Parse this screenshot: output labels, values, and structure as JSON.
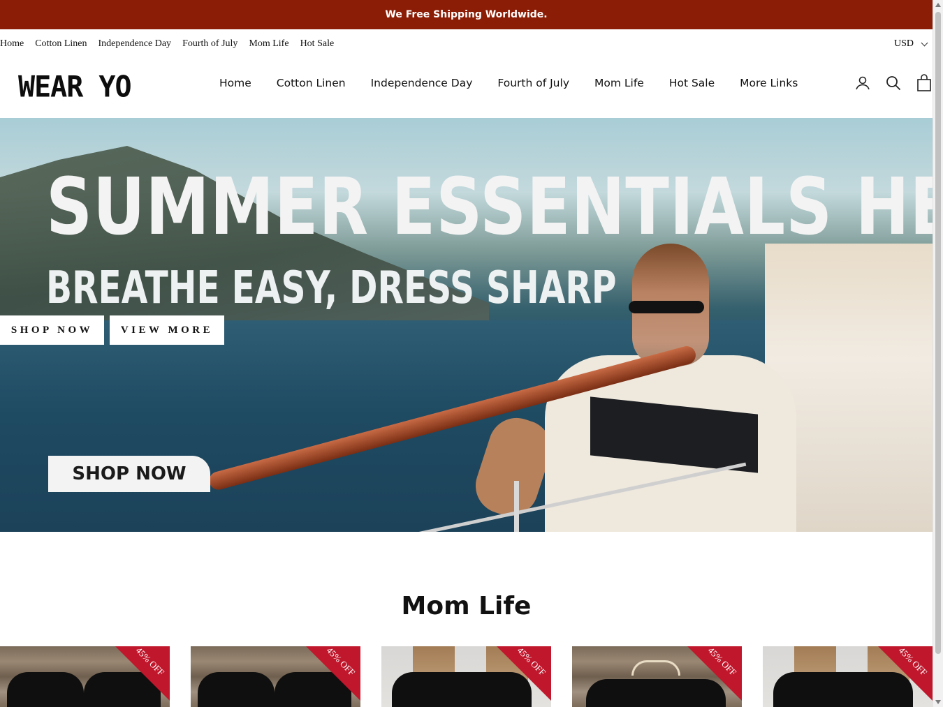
{
  "announcement": {
    "text": "We Free Shipping Worldwide."
  },
  "utility_nav": {
    "links": [
      "Home",
      "Cotton Linen",
      "Independence Day",
      "Fourth of July",
      "Mom Life",
      "Hot Sale"
    ],
    "currency": "USD"
  },
  "header": {
    "logo_text": "WEAR YO",
    "nav": [
      "Home",
      "Cotton Linen",
      "Independence Day",
      "Fourth of July",
      "Mom Life",
      "Hot Sale",
      "More Links"
    ],
    "icons": [
      "account-icon",
      "search-icon",
      "cart-icon"
    ]
  },
  "hero": {
    "title": "SUMMER ESSENTIALS HERE",
    "subtitle": "BREATHE EASY, DRESS SHARP",
    "shop_now_label": "SHOP NOW",
    "view_more_label": "VIEW MORE",
    "shop_now_big_label": "SHOP NOW"
  },
  "section": {
    "title": "Mom Life",
    "products": [
      {
        "badge": "45% OFF"
      },
      {
        "badge": "45% OFF"
      },
      {
        "badge": "45% OFF"
      },
      {
        "badge": "45% OFF"
      },
      {
        "badge": "45% OFF"
      }
    ]
  },
  "colors": {
    "announcement_bg": "#8b1c06",
    "badge_red": "#c0172c",
    "text": "#111111"
  }
}
